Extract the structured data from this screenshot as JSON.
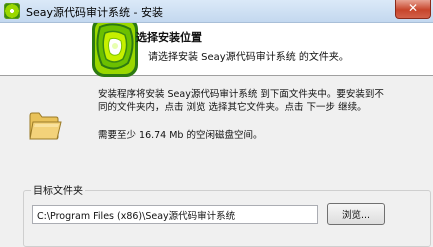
{
  "window": {
    "title": "Seay源代码审计系统 - 安装",
    "close_glyph": "✕"
  },
  "header": {
    "title": "选择安装位置",
    "subtitle": "请选择安装 Seay源代码审计系统 的文件夹。"
  },
  "body": {
    "description_line1": "安装程序将安装 Seay源代码审计系统 到下面文件夹中。要安装到不",
    "description_line2": "同的文件夹内，点击 浏览 选择其它文件夹。点击 下一步 继续。",
    "space_required": "需要至少 16.74 Mb 的空闲磁盘空间。"
  },
  "destination": {
    "group_label": "目标文件夹",
    "path_value": "C:\\Program Files (x86)\\Seay源代码审计系统",
    "browse_label": "浏览..."
  },
  "icons": {
    "app": "seay-app-icon",
    "folder": "folder-icon",
    "logo": "seay-logo"
  },
  "colors": {
    "logo_green": "#9ad800",
    "logo_dark": "#2d7a12",
    "folder_yellow": "#f3d27a",
    "close_red": "#c7452b"
  }
}
